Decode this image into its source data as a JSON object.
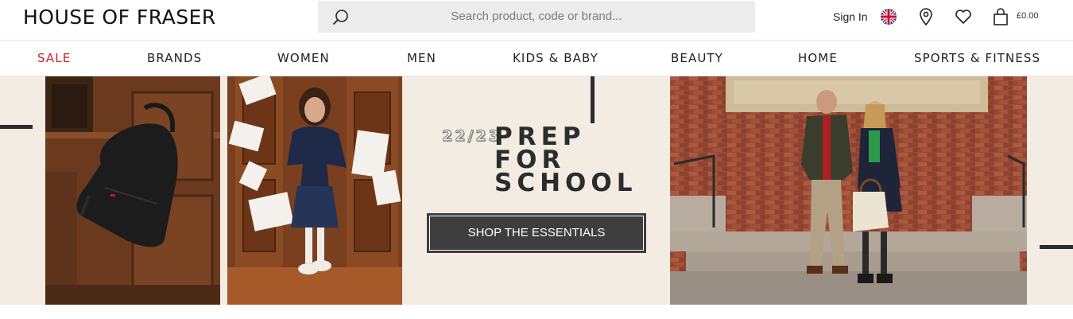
{
  "header": {
    "logo": "HOUSE OF FRASER",
    "search_placeholder": "Search product, code or brand...",
    "sign_in": "Sign In",
    "bag_total": "£0.00"
  },
  "nav": {
    "items": [
      "SALE",
      "BRANDS",
      "WOMEN",
      "MEN",
      "KIDS & BABY",
      "BEAUTY",
      "HOME",
      "SPORTS & FITNESS"
    ]
  },
  "hero": {
    "year": "22/23",
    "headline_line1": "PREP",
    "headline_line2": "FOR",
    "headline_line3": "SCHOOL",
    "cta_label": "SHOP THE ESSENTIALS"
  },
  "colors": {
    "sale": "#d2232a",
    "hero_background": "#f2ece3",
    "cta_background": "#3e3e3e",
    "search_background": "#ececec"
  },
  "icons": [
    "search-icon",
    "uk-flag-icon",
    "location-pin-icon",
    "heart-icon",
    "shopping-bag-icon"
  ]
}
